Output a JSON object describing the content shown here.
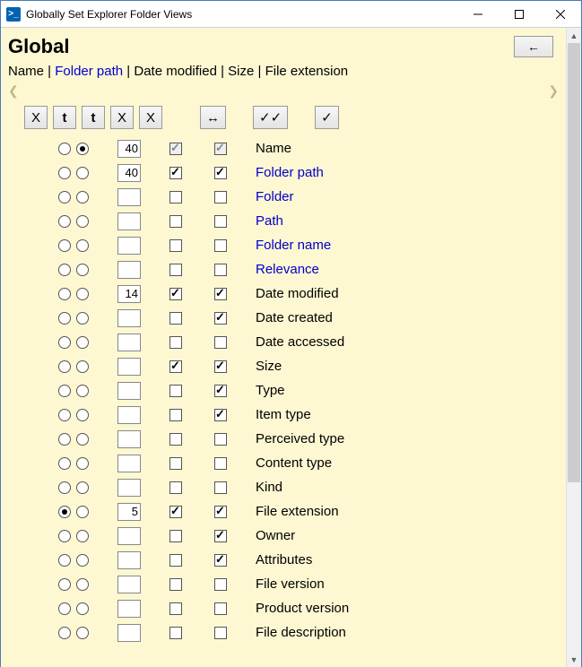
{
  "window": {
    "title": "Globally Set Explorer Folder Views"
  },
  "header": {
    "title": "Global",
    "back_label": "←"
  },
  "selected_line": {
    "parts": [
      {
        "text": "Name",
        "link": false
      },
      {
        "text": "Folder path",
        "link": true
      },
      {
        "text": "Date modified",
        "link": false
      },
      {
        "text": "Size",
        "link": false
      },
      {
        "text": "File extension",
        "link": false
      }
    ]
  },
  "toolbar": {
    "b1": "X",
    "b2": "t",
    "b3": "t",
    "b4": "X",
    "b5": "X",
    "b_width": "↔",
    "b_c1": "✓✓",
    "b_c2": "✓"
  },
  "rows": [
    {
      "r1": false,
      "r2": true,
      "w": "40",
      "wshow": true,
      "c1": true,
      "c1gray": true,
      "c2": true,
      "c2gray": true,
      "label": "Name",
      "link": false
    },
    {
      "r1": false,
      "r2": false,
      "w": "40",
      "wshow": true,
      "c1": true,
      "c1gray": false,
      "c2": true,
      "c2gray": false,
      "label": "Folder path",
      "link": true
    },
    {
      "r1": false,
      "r2": false,
      "w": "",
      "wshow": true,
      "c1": false,
      "c1gray": false,
      "c2": false,
      "c2gray": false,
      "label": "Folder",
      "link": true
    },
    {
      "r1": false,
      "r2": false,
      "w": "",
      "wshow": true,
      "c1": false,
      "c1gray": false,
      "c2": false,
      "c2gray": false,
      "label": "Path",
      "link": true
    },
    {
      "r1": false,
      "r2": false,
      "w": "",
      "wshow": true,
      "c1": false,
      "c1gray": false,
      "c2": false,
      "c2gray": false,
      "label": "Folder name",
      "link": true
    },
    {
      "r1": false,
      "r2": false,
      "w": "",
      "wshow": true,
      "c1": false,
      "c1gray": false,
      "c2": false,
      "c2gray": false,
      "label": "Relevance",
      "link": true
    },
    {
      "r1": false,
      "r2": false,
      "w": "14",
      "wshow": true,
      "c1": true,
      "c1gray": false,
      "c2": true,
      "c2gray": false,
      "label": "Date modified",
      "link": false
    },
    {
      "r1": false,
      "r2": false,
      "w": "",
      "wshow": true,
      "c1": false,
      "c1gray": false,
      "c2": true,
      "c2gray": false,
      "label": "Date created",
      "link": false
    },
    {
      "r1": false,
      "r2": false,
      "w": "",
      "wshow": true,
      "c1": false,
      "c1gray": false,
      "c2": false,
      "c2gray": false,
      "label": "Date accessed",
      "link": false
    },
    {
      "r1": false,
      "r2": false,
      "w": "",
      "wshow": true,
      "c1": true,
      "c1gray": false,
      "c2": true,
      "c2gray": false,
      "label": "Size",
      "link": false
    },
    {
      "r1": false,
      "r2": false,
      "w": "",
      "wshow": true,
      "c1": false,
      "c1gray": false,
      "c2": true,
      "c2gray": false,
      "label": "Type",
      "link": false
    },
    {
      "r1": false,
      "r2": false,
      "w": "",
      "wshow": true,
      "c1": false,
      "c1gray": false,
      "c2": true,
      "c2gray": false,
      "label": "Item type",
      "link": false
    },
    {
      "r1": false,
      "r2": false,
      "w": "",
      "wshow": true,
      "c1": false,
      "c1gray": false,
      "c2": false,
      "c2gray": false,
      "label": "Perceived type",
      "link": false
    },
    {
      "r1": false,
      "r2": false,
      "w": "",
      "wshow": true,
      "c1": false,
      "c1gray": false,
      "c2": false,
      "c2gray": false,
      "label": "Content type",
      "link": false
    },
    {
      "r1": false,
      "r2": false,
      "w": "",
      "wshow": true,
      "c1": false,
      "c1gray": false,
      "c2": false,
      "c2gray": false,
      "label": "Kind",
      "link": false
    },
    {
      "r1": true,
      "r2": false,
      "w": "5",
      "wshow": true,
      "c1": true,
      "c1gray": false,
      "c2": true,
      "c2gray": false,
      "label": "File extension",
      "link": false
    },
    {
      "r1": false,
      "r2": false,
      "w": "",
      "wshow": true,
      "c1": false,
      "c1gray": false,
      "c2": true,
      "c2gray": false,
      "label": "Owner",
      "link": false
    },
    {
      "r1": false,
      "r2": false,
      "w": "",
      "wshow": true,
      "c1": false,
      "c1gray": false,
      "c2": true,
      "c2gray": false,
      "label": "Attributes",
      "link": false
    },
    {
      "r1": false,
      "r2": false,
      "w": "",
      "wshow": true,
      "c1": false,
      "c1gray": false,
      "c2": false,
      "c2gray": false,
      "label": "File version",
      "link": false
    },
    {
      "r1": false,
      "r2": false,
      "w": "",
      "wshow": true,
      "c1": false,
      "c1gray": false,
      "c2": false,
      "c2gray": false,
      "label": "Product version",
      "link": false
    },
    {
      "r1": false,
      "r2": false,
      "w": "",
      "wshow": true,
      "c1": false,
      "c1gray": false,
      "c2": false,
      "c2gray": false,
      "label": "File description",
      "link": false
    }
  ]
}
